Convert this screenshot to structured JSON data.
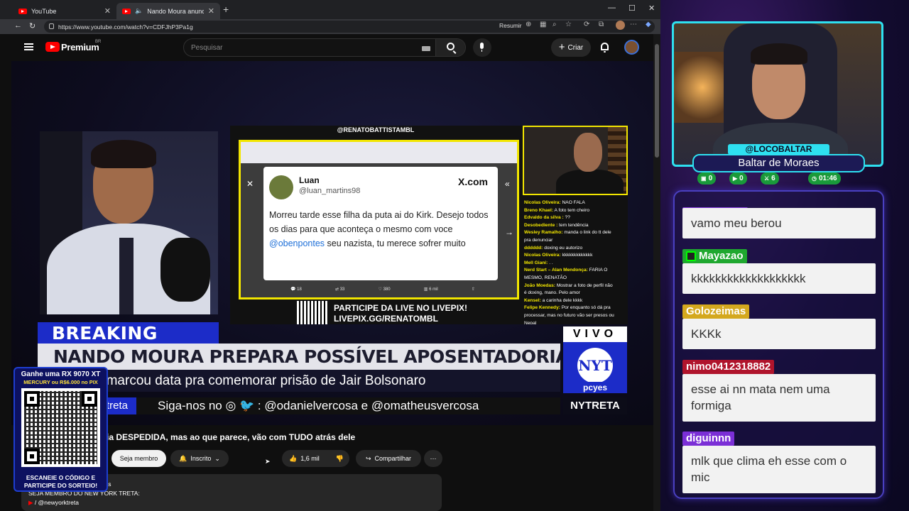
{
  "browser": {
    "tabs": [
      {
        "title": "YouTube"
      },
      {
        "title": "Nando Moura anuncia DESP"
      }
    ],
    "url": "https://www.youtube.com/watch?v=CDFJhP3Pa1g",
    "resumir_label": "Resumir"
  },
  "youtube": {
    "brand": "Premium",
    "region": "BR",
    "search_placeholder": "Pesquisar",
    "create_label": "Criar"
  },
  "video": {
    "stream_handle": "@RENATOBATTISTAMBL",
    "tweet": {
      "name": "Luan",
      "handle": "@luan_martins98",
      "site": "X.com",
      "text_before": "Morreu tarde esse filha da puta ai do Kirk. Desejo todos os dias para que aconteça o mesmo com voce ",
      "mention": "@obenpontes",
      "text_after": " seu nazista, tu merece sofrer muito",
      "stat_replies": "18",
      "stat_retweets": "33",
      "stat_likes": "380",
      "stat_views": "6 mil"
    },
    "stream_chat": [
      {
        "user": "Nicolas Oliveira:",
        "msg": "NAO FALA"
      },
      {
        "user": "Breno Khael:",
        "msg": "A foto tem cheiro"
      },
      {
        "user": "Edvaldo da silva :",
        "msg": "??"
      },
      {
        "user": "Desobediente :",
        "msg": "tem tendência"
      },
      {
        "user": "Wesley Ramalho:",
        "msg": "manda o link do tt dele"
      },
      {
        "user": "",
        "msg": "pra denunciar"
      },
      {
        "user": "dddddd:",
        "msg": "doxing eu autorizo"
      },
      {
        "user": "Nicolas Oliveira:",
        "msg": "kkkkkkkkkkkkk"
      },
      {
        "user": "Mell Giani:",
        "msg": ". ."
      },
      {
        "user": "Nerd Start – Alan Mendonça:",
        "msg": "FARIA O"
      },
      {
        "user": "",
        "msg": "MESMO, RENATÃO"
      },
      {
        "user": "João Moedas:",
        "msg": "Mostrar a foto de perfil não"
      },
      {
        "user": "",
        "msg": "é doxing, mano. Pelo amor"
      },
      {
        "user": "Kensel:",
        "msg": "a carinha dele kkkk"
      },
      {
        "user": "Felipe Kennedy:",
        "msg": "Por enquanto só dá pra"
      },
      {
        "user": "",
        "msg": "processar, mas no futuro vão ser presos ou"
      },
      {
        "user": "",
        "msg": "Nepal"
      },
      {
        "user": "Jeff Simmons:",
        "msg": "Hein, Twitter tá zoado demais"
      }
    ],
    "livepix_line1": "PARTICIPE DA LIVE NO LIVEPIX!",
    "livepix_line2": "LIVEPIX.GG/RENATOMBL",
    "breaking": "BREAKING NEWS",
    "headline": "NANDO MOURA PREPARA POSSÍVEL APOSENTADORIA DO CANAL",
    "subline": "r marcou data pra comemorar prisão de Jair Bolsonaro",
    "tag": "treta",
    "follow": "Siga-nos no ◎ 🐦 : @odanielvercosa e @omatheusvercosa",
    "vivo": "VIVO",
    "nyt": "NYT",
    "sponsor": "pcyes",
    "channel_tag": "NYTRETA"
  },
  "below": {
    "title": "ia DESPEDIDA, mas ao que parece, vão com TUDO atrás dele",
    "join_label": "Seja membro",
    "subscribed_label": "Inscrito",
    "likes": "1,6 mil",
    "share_label": "Compartilhar",
    "desc_line1": "oras",
    "desc_line2": "SEJA MEMBRO DO NEW YORK TRETA:",
    "desc_line3": "/ @newyorktreta"
  },
  "promo": {
    "line1": "Ganhe uma RX 9070 XT",
    "line2": "MERCURY ou R$6.000 no PIX",
    "line3": "ESCANEIE O CÓDIGO E",
    "line4": "PARTICIPE DO SORTEIO!"
  },
  "streamer": {
    "handle": "@LOCOBALTAR",
    "name": "Baltar de Moraes",
    "stats": [
      {
        "icon": "chat-icon",
        "value": "0"
      },
      {
        "icon": "youtube-icon",
        "value": "0"
      },
      {
        "icon": "sword-icon",
        "value": "6"
      },
      {
        "icon": "clock-icon",
        "value": "01:46"
      }
    ]
  },
  "chat": [
    {
      "user": "",
      "user_color": "#7b2fd6",
      "text": "vamo meu berou"
    },
    {
      "user": "Mayazao",
      "user_color": "#1fa82f",
      "text": "kkkkkkkkkkkkkkkkkkk"
    },
    {
      "user": "Golozeimas",
      "user_color": "#d4a81e",
      "text": "KKKk"
    },
    {
      "user": "nimo0412318882",
      "user_color": "#b0142c",
      "text": "esse ai nn mata nem uma formiga"
    },
    {
      "user": "diguinnn",
      "user_color": "#7b2fd6",
      "text": "mlk que clima eh esse com o mic"
    }
  ]
}
